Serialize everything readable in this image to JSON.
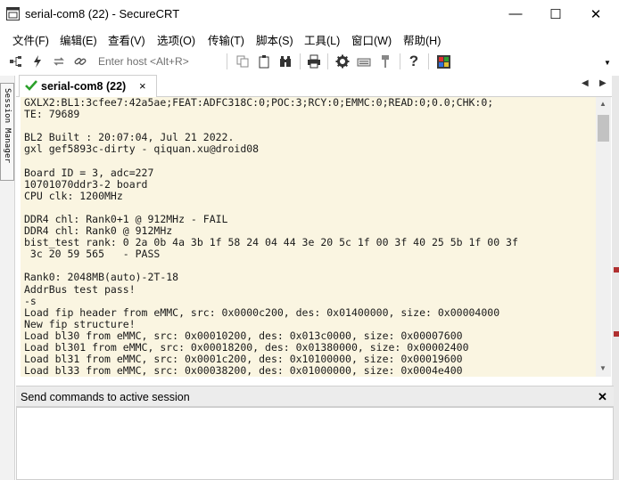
{
  "window": {
    "title": "serial-com8 (22) - SecureCRT",
    "minimize_glyph": "—",
    "maximize_glyph": "☐",
    "close_glyph": "✕"
  },
  "menu": [
    "文件(F)",
    "编辑(E)",
    "查看(V)",
    "选项(O)",
    "传输(T)",
    "脚本(S)",
    "工具(L)",
    "窗口(W)",
    "帮助(H)"
  ],
  "toolbar": {
    "host_placeholder": "Enter host <Alt+R>",
    "icons": [
      "connect-tree-icon",
      "quick-connect-icon",
      "reconnect-icon",
      "link-icon",
      "copy-icon",
      "paste-icon",
      "find-icon",
      "print-icon",
      "settings-icon",
      "keymap-icon",
      "tools-icon",
      "help-icon",
      "sftp-icon"
    ]
  },
  "session_manager": {
    "label": "Session Manager"
  },
  "tabs": {
    "active_label": "serial-com8 (22)",
    "close_glyph": "×",
    "nav_left": "◀",
    "nav_right": "▶"
  },
  "terminal": {
    "lines": [
      "GXLX2:BL1:3cfee7:42a5ae;FEAT:ADFC318C:0;POC:3;RCY:0;EMMC:0;READ:0;0.0;CHK:0;",
      "TE: 79689",
      "",
      "BL2 Built : 20:07:04, Jul 21 2022.",
      "gxl gef5893c-dirty - qiquan.xu@droid08",
      "",
      "Board ID = 3, adc=227",
      "10701070ddr3-2 board",
      "CPU clk: 1200MHz",
      "",
      "DDR4 chl: Rank0+1 @ 912MHz - FAIL",
      "DDR4 chl: Rank0 @ 912MHz",
      "bist_test rank: 0 2a 0b 4a 3b 1f 58 24 04 44 3e 20 5c 1f 00 3f 40 25 5b 1f 00 3f",
      " 3c 20 59 565   - PASS",
      "",
      "Rank0: 2048MB(auto)-2T-18",
      "AddrBus test pass!",
      "-s",
      "Load fip header from eMMC, src: 0x0000c200, des: 0x01400000, size: 0x00004000",
      "New fip structure!",
      "Load bl30 from eMMC, src: 0x00010200, des: 0x013c0000, size: 0x00007600",
      "Load bl301 from eMMC, src: 0x00018200, des: 0x01380000, size: 0x00002400",
      "Load bl31 from eMMC, src: 0x0001c200, des: 0x10100000, size: 0x00019600",
      "Load bl33 from eMMC, src: 0x00038200, des: 0x01000000, size: 0x0004e400"
    ],
    "background_color": "#faf5e1"
  },
  "scrollbar": {
    "up_glyph": "▲",
    "down_glyph": "▼"
  },
  "command_pane": {
    "title": "Send commands to active session",
    "close_glyph": "✕"
  }
}
